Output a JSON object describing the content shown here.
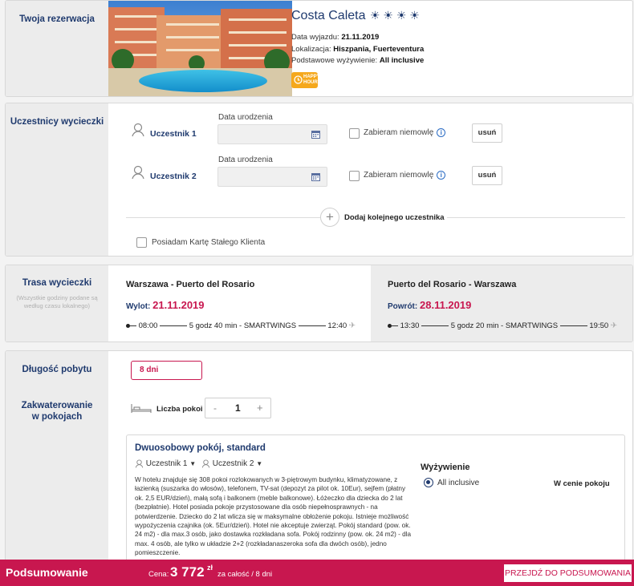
{
  "reservation": {
    "section_title": "Twoja rezerwacja",
    "hotel_name": "Costa Caleta",
    "stars": "☀ ☀ ☀ ☀",
    "departure_label": "Data wyjazdu:",
    "departure_value": "21.11.2019",
    "location_label": "Lokalizacja:",
    "location_value": "Hiszpania, Fuerteventura",
    "board_label": "Podstawowe wyżywienie:",
    "board_value": "All inclusive",
    "badge_line1": "HAPPY",
    "badge_line2": "HOURS"
  },
  "participants": {
    "section_title": "Uczestnicy wycieczki",
    "list": [
      {
        "label": "Uczestnik 1",
        "date_label": "Data urodzenia",
        "infant_label": "Zabieram niemowlę",
        "remove_label": "usuń"
      },
      {
        "label": "Uczestnik 2",
        "date_label": "Data urodzenia",
        "infant_label": "Zabieram niemowlę",
        "remove_label": "usuń"
      }
    ],
    "add_label": "Dodaj kolejnego uczestnika",
    "card_label": "Posiadam Kartę Stałego Klienta"
  },
  "route": {
    "section_title": "Trasa wycieczki",
    "hint": "(Wszystkie godziny podane są według czasu lokalnego)",
    "outbound": {
      "title": "Warszawa - Puerto del Rosario",
      "dep_label": "Wylot:",
      "date": "21.11.2019",
      "dep_time": "08:00",
      "info": "5 godz 40 min - SMARTWINGS",
      "arr_time": "12:40"
    },
    "return": {
      "title": "Puerto del Rosario - Warszawa",
      "dep_label": "Powrót:",
      "date": "28.11.2019",
      "dep_time": "13:30",
      "info": "5 godz 20 min - SMARTWINGS",
      "arr_time": "19:50"
    }
  },
  "stay": {
    "length_title": "Długość pobytu",
    "length_value": "8 dni",
    "rooms_title": "Zakwaterowanie w pokojach",
    "rooms_label": "Liczba pokoi",
    "minus": "-",
    "rooms_count": "1",
    "plus": "+",
    "room": {
      "title": "Dwuosobowy pokój, standard",
      "occupant1": "Uczestnik 1",
      "occupant2": "Uczestnik 2",
      "description": "W hotelu znajduje się 308 pokoi rozlokowanych w 3-piętrowym budynku, klimatyzowane, z łazienką (suszarka do włosów), telefonem, TV-sat (depozyt za pilot ok. 10Eur), sejfem (płatny ok. 2,5 EUR/dzień), małą sofą i balkonem (meble balkonowe). Łóżeczko dla dziecka do 2 lat (bezpłatnie). Hotel posiada pokoje przystosowane dla osób niepełnosprawnych - na potwierdzenie. Dziecko do 2 lat wlicza się w maksymalne obłożenie pokoju. Istnieje możliwość wypożyczenia czajnika (ok. 5Eur/dzień). Hotel nie akceptuje zwierząt. Pokój standard (pow. ok. 24 m2) - dla max.3 osób, jako dostawka rozkładana sofa. Pokój rodzinny (pow. ok. 24 m2) - dla max. 4 osób, ale tylko w układzie 2+2 (rozkładanaszeroka sofa dla dwóch osób), jedno pomieszczenie.",
      "meal_title": "Wyżywienie",
      "meal_option": "All inclusive",
      "meal_price": "W cenie pokoju"
    }
  },
  "summary_bar": {
    "title": "Podsumowanie",
    "price_label": "Cena:",
    "price": "3 772",
    "currency": "zł",
    "price_suffix": "za całość / 8 dni",
    "button": "PRZEJDŹ DO PODSUMOWANIA"
  }
}
